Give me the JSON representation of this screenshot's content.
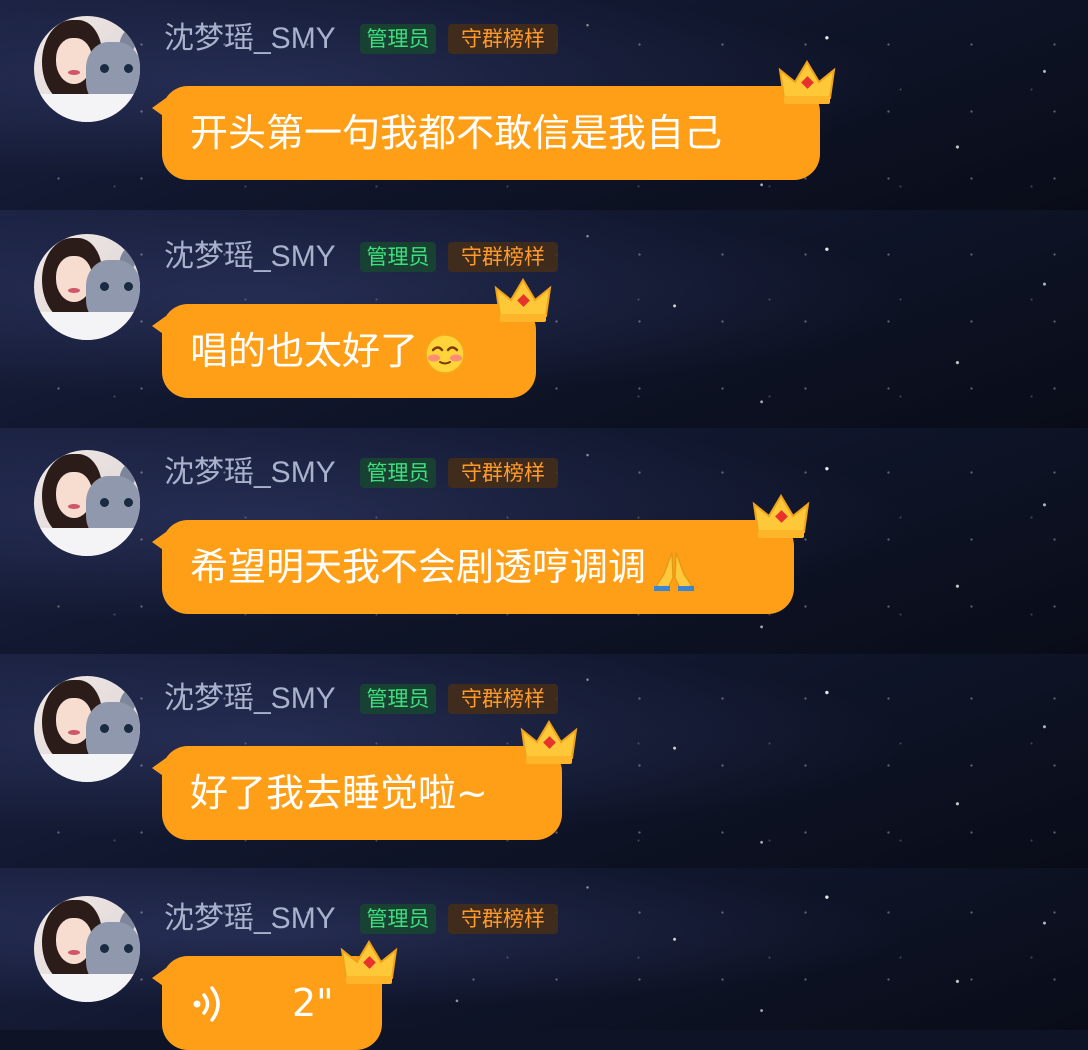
{
  "messages": [
    {
      "sender": "沈梦瑶_SMY",
      "badges": [
        "管理员",
        "守群榜样"
      ],
      "text": "开头第一句我都不敢信是我自己"
    },
    {
      "sender": "沈梦瑶_SMY",
      "badges": [
        "管理员",
        "守群榜样"
      ],
      "text": "唱的也太好了",
      "emoji": "blushing-face-icon"
    },
    {
      "sender": "沈梦瑶_SMY",
      "badges": [
        "管理员",
        "守群榜样"
      ],
      "text": "希望明天我不会剧透哼调调",
      "emoji": "folded-hands-icon"
    },
    {
      "sender": "沈梦瑶_SMY",
      "badges": [
        "管理员",
        "守群榜样"
      ],
      "text": "好了我去睡觉啦~"
    },
    {
      "sender": "沈梦瑶_SMY",
      "badges": [
        "管理员",
        "守群榜样"
      ],
      "voice": {
        "icon": "voice-wave-icon",
        "duration": "2\""
      }
    }
  ],
  "colors": {
    "bubble": "#ff9f18",
    "nickname": "#a9b2cc",
    "admin_badge_text": "#3ee07c",
    "fan_badge_text": "#ff9a2c",
    "background": "#10162c"
  }
}
